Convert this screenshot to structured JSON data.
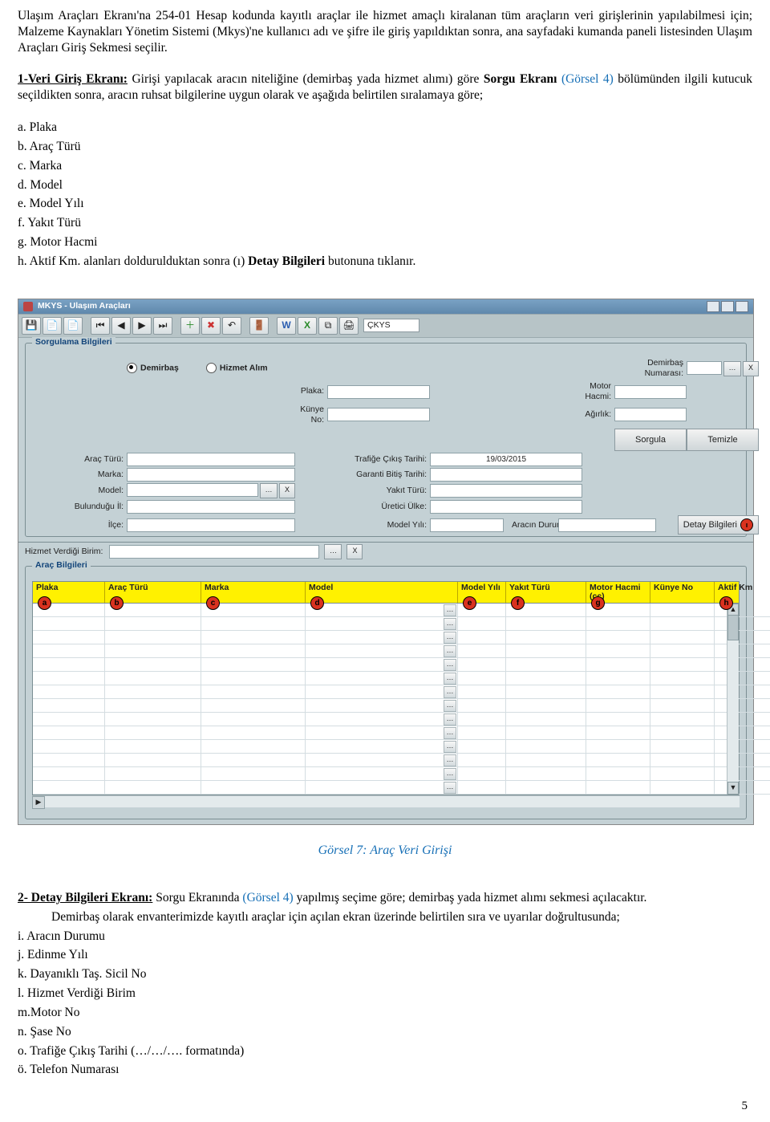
{
  "para1": "Ulaşım Araçları Ekranı'na 254-01 Hesap kodunda kayıtlı araçlar ile hizmet amaçlı kiralanan tüm araçların veri girişlerinin yapılabilmesi için; Malzeme Kaynakları Yönetim Sistemi (Mkys)'ne kullanıcı adı ve şifre ile giriş yapıldıktan sonra, ana sayfadaki kumanda paneli listesinden Ulaşım Araçları Giriş Sekmesi seçilir.",
  "section1": {
    "lead_u": "1-Veri Giriş Ekranı:",
    "lead_rest": " Girişi yapılacak aracın niteliğine (demirbaş yada hizmet alımı) göre ",
    "lead_b": "Sorgu Ekranı",
    "lead_after": " ",
    "gorsel": " (Görsel 4)",
    "lead_end": " bölümünden ilgili kutucuk seçildikten sonra, aracın ruhsat bilgilerine uygun olarak ve aşağıda belirtilen sıralamaya göre;"
  },
  "list1": {
    "a": "a. Plaka",
    "b": "b. Araç Türü",
    "c": "c. Marka",
    "d": "d. Model",
    "e": "e. Model Yılı",
    "f": "f. Yakıt Türü",
    "g": "g. Motor Hacmi",
    "h_pre": "h. Aktif Km. alanları doldurulduktan sonra (ı) ",
    "h_b": "Detay Bilgileri",
    "h_post": " butonuna tıklanır."
  },
  "app": {
    "title": "MKYS - Ulaşım Araçları",
    "ckys": "ÇKYS",
    "group_sorgu": "Sorgulama Bilgileri",
    "group_arac": "Araç Bilgileri",
    "radio1": "Demirbaş",
    "radio2": "Hizmet Alım",
    "labels": {
      "plaka": "Plaka:",
      "kunye": "Künye No:",
      "aracturu": "Araç Türü:",
      "marka": "Marka:",
      "model": "Model:",
      "bulunduguil": "Bulunduğu İl:",
      "ilce": "İlçe:",
      "hizmetbirim": "Hizmet Verdiği Birim:",
      "demirbasno": "Demirbaş Numarası:",
      "motorhacmi": "Motor Hacmi:",
      "agirlik": "Ağırlık:",
      "trafcikis": "Trafiğe Çıkış Tarihi:",
      "garantibitis": "Garanti Bitiş Tarihi:",
      "yakitturu": "Yakıt Türü:",
      "ureticiulke": "Üretici Ülke:",
      "modelyili": "Model Yılı:",
      "aracindurumu": "Aracın Durumu:"
    },
    "btn_sorgula": "Sorgula",
    "btn_temizle": "Temizle",
    "btn_detay": "Detay Bilgileri",
    "date": "19/03/2015",
    "cols": {
      "plaka": "Plaka",
      "aracturu": "Araç Türü",
      "marka": "Marka",
      "model": "Model",
      "modelyili": "Model Yılı",
      "yakitturu": "Yakıt Türü",
      "motorhacmi": "Motor Hacmi (cc)",
      "kunyeno": "Künye No",
      "aktifkm": "Aktif Km"
    },
    "badges": {
      "a": "a",
      "b": "b",
      "c": "c",
      "d": "d",
      "e": "e",
      "f": "f",
      "g": "g",
      "h": "h",
      "i": "ı"
    }
  },
  "fig_caption": "Görsel 7: Araç Veri Girişi",
  "section2": {
    "lead_u": "2- Detay Bilgileri Ekranı:",
    "lead_rest": " Sorgu Ekranında ",
    "gorsel": "(Görsel 4)",
    "lead_end": " yapılmış seçime göre; demirbaş yada hizmet alımı sekmesi açılacaktır.",
    "para2": "Demirbaş olarak envanterimizde kayıtlı araçlar için açılan ekran üzerinde belirtilen sıra ve uyarılar doğrultusunda;"
  },
  "list2": {
    "i": "i. Aracın Durumu",
    "j": "j. Edinme Yılı",
    "k": "k. Dayanıklı Taş. Sicil No",
    "l": "l. Hizmet Verdiği Birim",
    "m": "m.Motor No",
    "n": "n. Şase No",
    "o": "o. Trafiğe Çıkış Tarihi (…/…/…. formatında)",
    "oo": "ö. Telefon Numarası"
  },
  "pagenum": "5"
}
